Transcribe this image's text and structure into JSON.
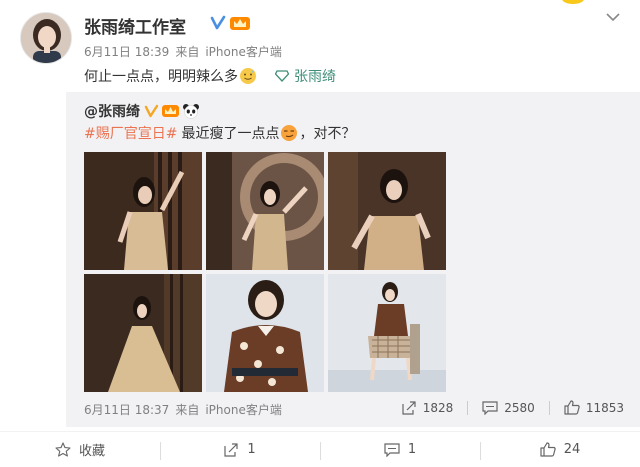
{
  "post": {
    "author": "张雨绮工作室",
    "date": "6月11日 18:39",
    "source_prefix": "来自",
    "source": "iPhone客户端",
    "text": "何止一点点，明明辣么多",
    "mention_link": "张雨绮",
    "icons": {
      "verified": "verified-v-icon",
      "crown": "crown-badge-icon",
      "emoji": "sweat-smile-emoji-icon",
      "super_topic": "diamond-link-icon",
      "menu": "chevron-down-icon"
    }
  },
  "retweet": {
    "author": "@张雨绮",
    "topic": "#赐厂官宣日#",
    "text_a": "最近瘦了一点点",
    "text_b": "，对不？",
    "date": "6月11日 18:37",
    "source_prefix": "来自",
    "source": "iPhone客户端",
    "stats": {
      "repost": "1828",
      "comment": "2580",
      "like": "11853"
    },
    "photos": [
      {
        "label": "gold-dress-photo-1"
      },
      {
        "label": "gold-dress-photo-2"
      },
      {
        "label": "gold-dress-photo-3"
      },
      {
        "label": "gold-gown-photo-4"
      },
      {
        "label": "floral-jacket-photo-5"
      },
      {
        "label": "plaid-skirt-photo-6"
      }
    ]
  },
  "actions": {
    "favorite": "收藏",
    "repost": "1",
    "comment": "1",
    "like": "24"
  },
  "colors": {
    "link_green": "#3e8e78",
    "topic_orange": "#eb7350",
    "verified_gold": "#f5a623",
    "retweet_bg": "#f2f2f5"
  }
}
